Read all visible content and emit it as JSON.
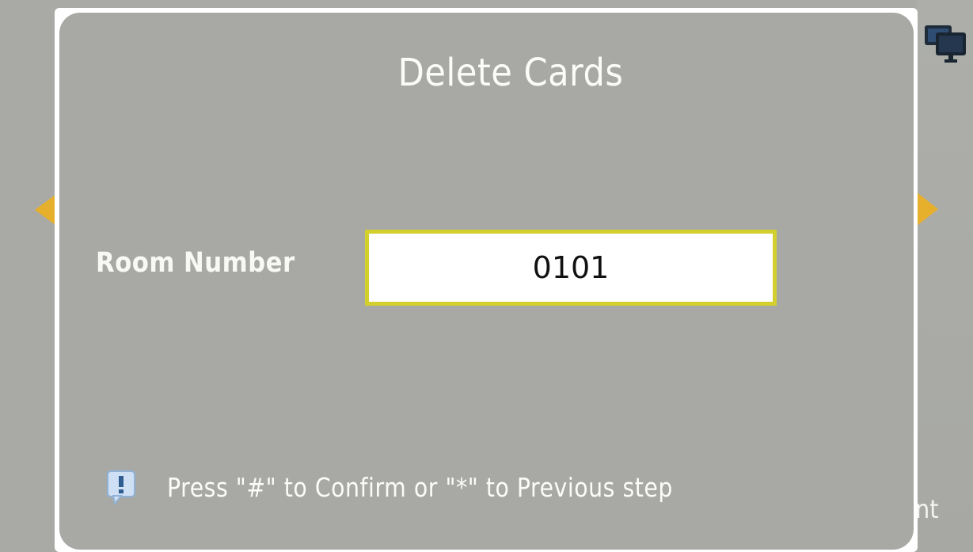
{
  "dialog": {
    "title": "Delete Cards",
    "field": {
      "label": "Room Number",
      "value": "0101"
    },
    "hint": "Press \"#\" to Confirm or \"*\" to Previous step"
  },
  "background": {
    "partial_text": "nt"
  },
  "icons": {
    "top_right": "monitors-icon",
    "hint": "info-speech-bubble-icon",
    "left_nav": "arrow-left-icon",
    "right_nav": "arrow-right-icon"
  },
  "colors": {
    "background_gray": "#a9aaa6",
    "dialog_gray": "#a8a9a5",
    "input_border": "#d3cf2d",
    "nav_arrow": "#e7b02c",
    "text_light": "#fbfbf8"
  }
}
